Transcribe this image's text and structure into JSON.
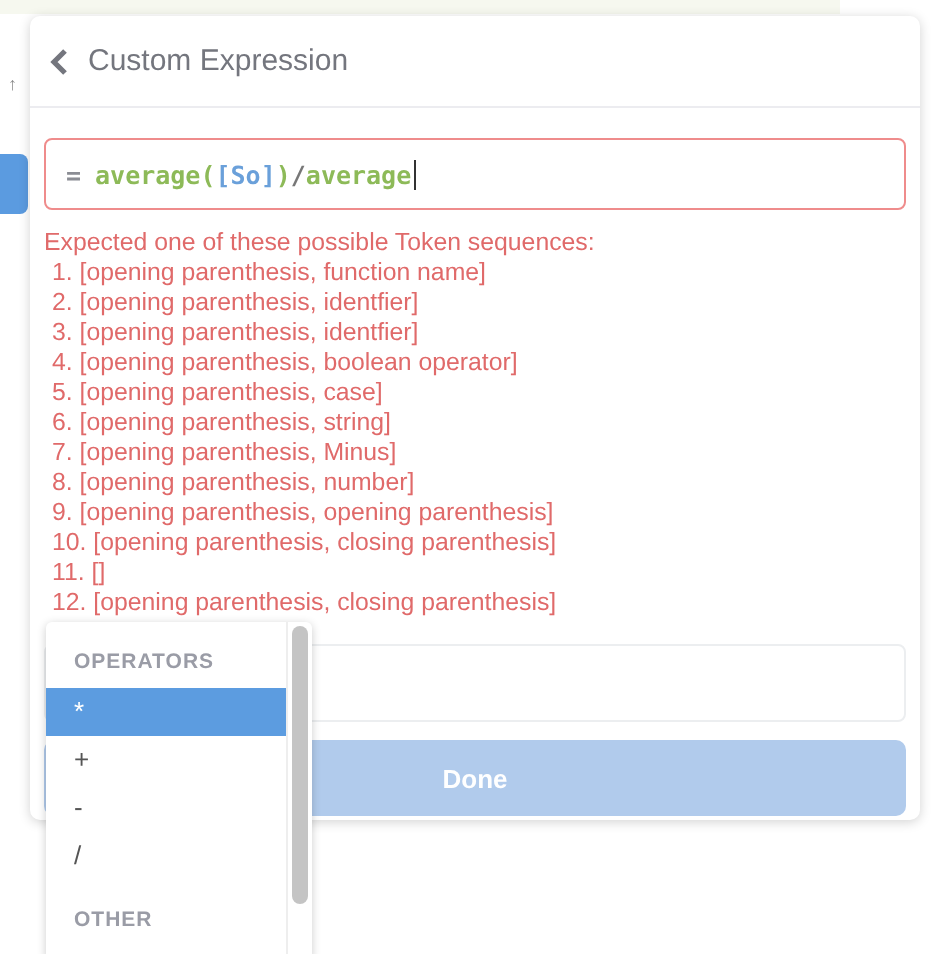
{
  "background_page": {
    "arrow_glyph": "↑"
  },
  "popover": {
    "title": "Custom Expression",
    "expression": {
      "invalid": true,
      "tokens": [
        {
          "kind": "equals",
          "text": "="
        },
        {
          "kind": "function",
          "text": "average("
        },
        {
          "kind": "field",
          "text": "[So]"
        },
        {
          "kind": "function",
          "text": ")"
        },
        {
          "kind": "operator",
          "text": "/"
        },
        {
          "kind": "function",
          "text": "average"
        }
      ]
    },
    "error": {
      "heading": "Expected one of these possible Token sequences:",
      "items": [
        "1. [opening parenthesis, function name]",
        "2. [opening parenthesis, identfier]",
        "3. [opening parenthesis, identfier]",
        "4. [opening parenthesis, boolean operator]",
        "5. [opening parenthesis, case]",
        "6. [opening parenthesis, string]",
        "7. [opening parenthesis, Minus]",
        "8. [opening parenthesis, number]",
        "9. [opening parenthesis, opening parenthesis]",
        "10. [opening parenthesis, closing parenthesis]",
        "11. []",
        "12. [opening parenthesis, closing parenthesis]"
      ]
    },
    "done_button": {
      "label": "Done",
      "disabled": true
    }
  },
  "suggestions": {
    "sections": [
      {
        "label": "OPERATORS",
        "items": [
          {
            "text": "*",
            "selected": true
          },
          {
            "text": "+",
            "selected": false
          },
          {
            "text": "-",
            "selected": false
          },
          {
            "text": "/",
            "selected": false
          }
        ]
      },
      {
        "label": "OTHER"
      }
    ]
  }
}
